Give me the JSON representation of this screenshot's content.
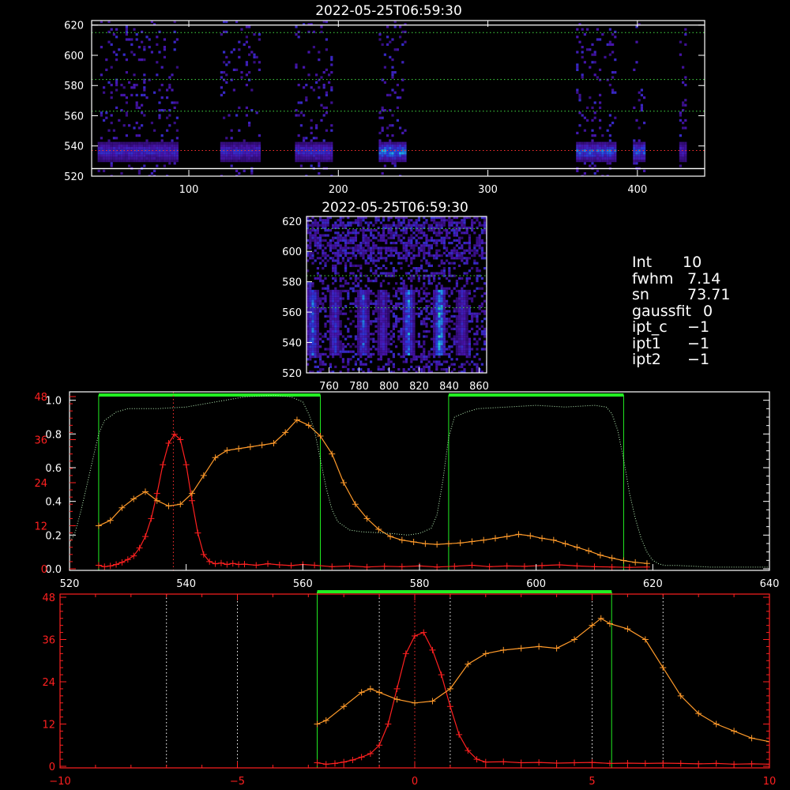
{
  "chart_data": [
    {
      "id": "overview",
      "type": "heatmap",
      "title": "2022-05-25T06:59:30",
      "xlim": [
        35,
        445
      ],
      "ylim": [
        520,
        623
      ],
      "xticks": [
        100,
        200,
        300,
        400
      ],
      "yticks": [
        520,
        540,
        560,
        580,
        600,
        620
      ],
      "bands": [
        [
          39,
          92
        ],
        [
          121,
          148
        ],
        [
          171,
          195
        ],
        [
          227,
          245
        ],
        [
          359,
          385
        ],
        [
          397,
          405
        ],
        [
          428,
          432
        ]
      ],
      "band_intensity": [
        0.55,
        0.55,
        0.6,
        0.9,
        0.75,
        0.8,
        0.5
      ],
      "signal_center": 537,
      "hlines": [
        {
          "y": 537,
          "color": "#ff3030"
        },
        {
          "y": 563,
          "color": "#44dd44"
        },
        {
          "y": 584,
          "color": "#44dd44"
        },
        {
          "y": 615,
          "color": "#44dd44"
        },
        {
          "y": 525,
          "color": "#ffffff"
        },
        {
          "y": 620,
          "color": "#ffffff"
        }
      ]
    },
    {
      "id": "zoom",
      "type": "heatmap",
      "title": "2022-05-25T06:59:30",
      "xlim": [
        745,
        865
      ],
      "ylim": [
        520,
        623
      ],
      "xticks": [
        760,
        780,
        800,
        820,
        840,
        860
      ],
      "yticks": [
        520,
        540,
        560,
        580,
        600,
        620
      ],
      "streaks": [
        [
          748,
          0.8
        ],
        [
          763,
          0.6
        ],
        [
          782,
          0.7
        ],
        [
          795,
          0.5
        ],
        [
          812,
          0.85
        ],
        [
          833,
          1.0
        ],
        [
          848,
          0.5
        ]
      ],
      "hlines": [
        {
          "y": 563,
          "color": "#44dd44"
        },
        {
          "y": 584,
          "color": "#44dd44"
        },
        {
          "y": 615,
          "color": "#44dd44"
        }
      ]
    },
    {
      "id": "spectrum",
      "type": "line",
      "xlim": [
        520,
        640
      ],
      "xticks": [
        520,
        540,
        560,
        580,
        600,
        620,
        640
      ],
      "y_left_ticks": [
        0.0,
        0.2,
        0.4,
        0.6,
        0.8,
        1.0
      ],
      "y_left_labels": [
        "0.0",
        "0.2",
        "0.4",
        "0.6",
        "0.8",
        "1.0"
      ],
      "y_right_ticks": [
        0,
        12,
        24,
        36,
        48
      ],
      "y_right_labels": [
        "0",
        "12",
        "24",
        "36",
        "48"
      ],
      "ylim_left": [
        0,
        1.05
      ],
      "ylim_right": [
        0,
        48
      ],
      "windows": [
        [
          525,
          563
        ],
        [
          585,
          615
        ]
      ],
      "peak_line": 537.8,
      "series": [
        {
          "color": "#ff2020",
          "axis": "right",
          "marker": "+",
          "x": [
            525,
            526,
            527,
            528,
            529,
            530,
            531,
            532,
            533,
            534,
            535,
            536,
            537,
            538,
            539,
            540,
            541,
            542,
            543,
            544,
            545,
            546,
            547,
            548,
            549,
            550,
            552,
            554,
            556,
            558,
            560,
            562,
            565,
            568,
            571,
            574,
            577,
            580,
            583,
            586,
            589,
            592,
            595,
            598,
            601,
            604,
            607,
            610,
            613,
            616,
            619
          ],
          "y": [
            1,
            0.6,
            0.8,
            1.2,
            1.8,
            2.6,
            3.6,
            5.8,
            9,
            14,
            21,
            29,
            35,
            37.5,
            36,
            29,
            19,
            10,
            4,
            2,
            1.4,
            1.6,
            1.2,
            1.5,
            1.2,
            1.3,
            1.0,
            1.4,
            1.1,
            0.9,
            1.2,
            1.0,
            0.6,
            0.8,
            0.5,
            0.7,
            0.6,
            0.8,
            0.5,
            0.7,
            1.0,
            0.6,
            0.8,
            0.7,
            0.9,
            1.1,
            0.8,
            0.6,
            0.5,
            0.4,
            0.5
          ]
        },
        {
          "color": "#ff9a2a",
          "axis": "right",
          "marker": "+",
          "x": [
            525,
            527,
            529,
            531,
            533,
            535,
            537,
            539,
            541,
            543,
            545,
            547,
            549,
            551,
            553,
            555,
            557,
            559,
            561,
            563,
            565,
            567,
            569,
            571,
            573,
            575,
            577,
            579,
            581,
            583,
            585,
            587,
            589,
            591,
            593,
            595,
            597,
            599,
            601,
            603,
            605,
            607,
            609,
            611,
            613,
            615,
            617,
            619
          ],
          "y": [
            12,
            13.5,
            17,
            19.5,
            21.5,
            19,
            17.5,
            18,
            21,
            26,
            31,
            33,
            33.5,
            34,
            34.5,
            35,
            38,
            41.5,
            40,
            37,
            32,
            24,
            18,
            14,
            11,
            9,
            8,
            7.5,
            7,
            6.8,
            7,
            7.2,
            7.6,
            8,
            8.5,
            9,
            9.6,
            9.2,
            8.5,
            8,
            7,
            6,
            5,
            3.8,
            3,
            2.3,
            1.8,
            1.5
          ]
        },
        {
          "color": "#b8f0b8",
          "axis": "left",
          "marker": "",
          "dotted": true,
          "x": [
            520,
            521,
            522,
            523,
            524,
            525,
            526,
            528,
            530,
            535,
            540,
            545,
            550,
            555,
            558,
            560,
            561,
            562,
            563,
            564,
            565,
            566,
            568,
            570,
            575,
            578,
            580,
            582,
            583,
            584,
            585,
            586,
            588,
            590,
            595,
            600,
            605,
            610,
            612,
            613,
            614,
            615,
            616,
            617,
            618,
            619,
            620,
            621,
            622,
            624,
            630,
            635,
            640
          ],
          "y": [
            0.15,
            0.22,
            0.35,
            0.5,
            0.65,
            0.8,
            0.88,
            0.93,
            0.95,
            0.95,
            0.96,
            0.99,
            1.02,
            1.03,
            1.02,
            0.99,
            0.92,
            0.82,
            0.65,
            0.48,
            0.35,
            0.28,
            0.23,
            0.22,
            0.21,
            0.2,
            0.21,
            0.24,
            0.32,
            0.52,
            0.78,
            0.9,
            0.93,
            0.95,
            0.96,
            0.97,
            0.96,
            0.97,
            0.96,
            0.92,
            0.82,
            0.65,
            0.45,
            0.3,
            0.18,
            0.1,
            0.05,
            0.03,
            0.02,
            0.02,
            0.01,
            0.01,
            0.01
          ]
        }
      ]
    },
    {
      "id": "velocity",
      "type": "line",
      "xlim": [
        -10,
        10
      ],
      "xticks": [
        -10,
        -5,
        0,
        5,
        10
      ],
      "xtick_labels": [
        "−10",
        "−5",
        "0",
        "5",
        "10"
      ],
      "y_right_ticks": [
        0,
        12,
        24,
        36,
        48
      ],
      "y_right_labels": [
        "0",
        "12",
        "24",
        "36",
        "48"
      ],
      "ylim": [
        0,
        48
      ],
      "window": [
        -2.75,
        5.55
      ],
      "vlines_white": [
        -7,
        -5,
        -1,
        1,
        5,
        7
      ],
      "vline_red": 0,
      "series": [
        {
          "color": "#ff2020",
          "marker": "+",
          "x": [
            -2.75,
            -2.5,
            -2.25,
            -2,
            -1.75,
            -1.5,
            -1.25,
            -1,
            -0.75,
            -0.5,
            -0.25,
            0,
            0.25,
            0.5,
            0.75,
            1,
            1.25,
            1.5,
            1.75,
            2,
            2.5,
            3,
            3.5,
            4,
            4.5,
            5,
            5.5,
            6,
            6.5,
            7,
            7.5,
            8,
            8.5,
            9,
            9.5,
            10
          ],
          "y": [
            1,
            0.6,
            0.8,
            1.2,
            1.8,
            2.6,
            3.6,
            6,
            12,
            22,
            32,
            37,
            38,
            33,
            26,
            17,
            9,
            4.5,
            2,
            1.2,
            1.3,
            1.0,
            1.1,
            0.9,
            1.0,
            1.1,
            0.8,
            0.9,
            0.8,
            0.9,
            0.8,
            0.7,
            0.8,
            0.6,
            0.7,
            0.6
          ]
        },
        {
          "color": "#ff9a2a",
          "marker": "+",
          "x": [
            -2.75,
            -2.5,
            -2,
            -1.5,
            -1.25,
            -1,
            -0.5,
            0,
            0.5,
            1,
            1.5,
            2,
            2.5,
            3,
            3.5,
            4,
            4.5,
            5,
            5.25,
            5.5,
            6,
            6.5,
            7,
            7.5,
            8,
            8.5,
            9,
            9.5,
            10
          ],
          "y": [
            12,
            13,
            17,
            21,
            22,
            21,
            19,
            18,
            18.5,
            22,
            29,
            32,
            33,
            33.5,
            34,
            33.5,
            36,
            40,
            42,
            40.5,
            39,
            36,
            28,
            20,
            15,
            12,
            10,
            8,
            7
          ]
        }
      ]
    }
  ],
  "info_panel": {
    "rows": [
      {
        "label": "Int",
        "value": "10"
      },
      {
        "label": "fwhm",
        "value": " 7.14"
      },
      {
        "label": "sn",
        "value": " 73.71"
      },
      {
        "label": "gaussfit",
        "value": "0"
      },
      {
        "label": "ipt_c",
        "value": " −1"
      },
      {
        "label": "ipt1",
        "value": " −1"
      },
      {
        "label": "ipt2",
        "value": " −1"
      }
    ]
  },
  "colors": {
    "axis_white": "#ffffff",
    "axis_red": "#ff2020",
    "window_green": "#22ee22",
    "hline_green": "#44dd44",
    "heat_low": "#3b0a8a",
    "heat_high": "#40ffb0"
  }
}
